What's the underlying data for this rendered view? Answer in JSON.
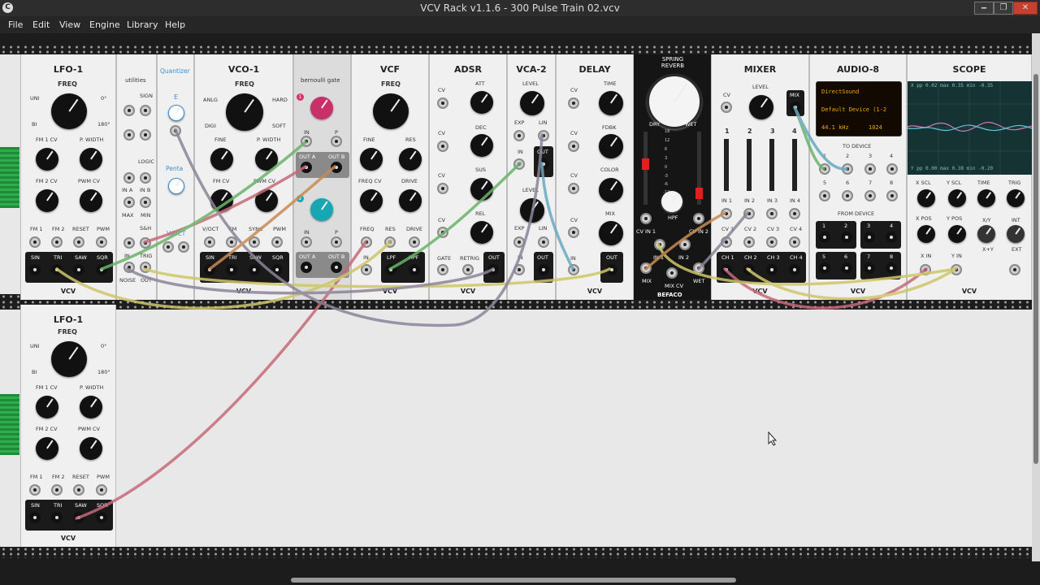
{
  "window": {
    "title": "VCV Rack v1.1.6 - 300 Pulse Train 02.vcv",
    "logo": "C",
    "controls": [
      "🗕",
      "❐",
      "✕"
    ]
  },
  "menu": [
    "File",
    "Edit",
    "View",
    "Engine",
    "Library",
    "Help"
  ],
  "modules": {
    "lfo1": {
      "title": "LFO-1",
      "freq": "FREQ",
      "uni": "UNI",
      "bi": "BI",
      "deg0": "0°",
      "deg180": "180°",
      "fm1cv": "FM 1 CV",
      "pwidth": "P. WIDTH",
      "fm2cv": "FM 2 CV",
      "pwmcv": "PWM CV",
      "in_labels": [
        "FM 1",
        "FM 2",
        "RESET",
        "PWM"
      ],
      "out_labels": [
        "SIN",
        "TRI",
        "SAW",
        "SQR"
      ],
      "logo": "VCV"
    },
    "utilities": {
      "title": "utilities",
      "sign": "SIGN",
      "logic": "LOGIC",
      "ina": "IN A",
      "inb": "IN B",
      "max": "MAX",
      "min": "MIN",
      "sh": "S&H",
      "in": "IN",
      "trig": "TRIG",
      "noise": "NOISE",
      "out": "OUT"
    },
    "quantizer": {
      "title": "Quantizer",
      "scale1": "E",
      "scale2": "Penta",
      "voct": "V/OCT"
    },
    "vco1": {
      "title": "VCO-1",
      "freq": "FREQ",
      "anlg": "ANLG",
      "digi": "DIGI",
      "hard": "HARD",
      "soft": "SOFT",
      "fine": "FINE",
      "pwidth": "P. WIDTH",
      "fmcv": "FM CV",
      "pwmcv": "PWM CV",
      "in_labels": [
        "V/OCT",
        "FM",
        "SYNC",
        "PWM"
      ],
      "out_labels": [
        "SIN",
        "TRI",
        "SAW",
        "SQR"
      ],
      "logo": "VCV"
    },
    "bernoulli": {
      "title": "bernoulli gate",
      "in": "IN",
      "p": "P",
      "outa": "OUT A",
      "outb": "OUT B",
      "n1": "1",
      "n2": "2"
    },
    "vcf": {
      "title": "VCF",
      "freq": "FREQ",
      "fine": "FINE",
      "res": "RES",
      "freqcv": "FREQ CV",
      "drive": "DRIVE",
      "in_labels": [
        "FREQ",
        "RES",
        "DRIVE"
      ],
      "out_labels": [
        "IN",
        "LPF",
        "HPF"
      ],
      "logo": "VCV"
    },
    "adsr": {
      "title": "ADSR",
      "att": "ATT",
      "dec": "DEC",
      "sus": "SUS",
      "rel": "REL",
      "cv": "CV",
      "gate": "GATE",
      "retrig": "RETRIG",
      "out": "OUT",
      "logo": "VCV"
    },
    "vca2": {
      "title": "VCA-2",
      "level": "LEVEL",
      "exp": "EXP",
      "lin": "LIN",
      "in": "IN",
      "out": "OUT",
      "logo": "VCV"
    },
    "delay": {
      "title": "DELAY",
      "time": "TIME",
      "fdbk": "FDBK",
      "color": "COLOR",
      "mix": "MIX",
      "cv": "CV",
      "in": "IN",
      "out": "OUT",
      "logo": "VCV"
    },
    "spring": {
      "title": "SPRING REVERB",
      "dry": "DRY",
      "wet": "WET",
      "hpf": "HPF",
      "scale": [
        "18",
        "12",
        "6",
        "3",
        "0",
        "-3",
        "-6",
        "-12",
        "dB"
      ],
      "cvin1": "CV IN 1",
      "cvin2": "CV IN 2",
      "in1": "IN 1",
      "in2": "IN 2",
      "mix": "MIX",
      "mixcv": "MIX CV",
      "brand": "BEFACO"
    },
    "mixer": {
      "title": "MIXER",
      "level": "LEVEL",
      "cv": "CV",
      "mix": "MIX",
      "ch_nums": [
        "1",
        "2",
        "3",
        "4"
      ],
      "in_labels": [
        "IN 1",
        "IN 2",
        "IN 3",
        "IN 4"
      ],
      "cv_labels": [
        "CV 1",
        "CV 2",
        "CV 3",
        "CV 4"
      ],
      "out_labels": [
        "CH 1",
        "CH 2",
        "CH 3",
        "CH 4"
      ],
      "logo": "VCV"
    },
    "audio8": {
      "title": "AUDIO-8",
      "driver": "DirectSound",
      "device": "Default Device (1-2",
      "rate": "44.1 kHz",
      "block": "1024",
      "to_device": "TO DEVICE",
      "from_device": "FROM DEVICE",
      "to_nums": [
        "1",
        "2",
        "3",
        "4",
        "5",
        "6",
        "7",
        "8"
      ],
      "from_nums": [
        "1",
        "2",
        "3",
        "4",
        "5",
        "6",
        "7",
        "8"
      ],
      "logo": "VCV"
    },
    "scope": {
      "title": "SCOPE",
      "hdr1": "X  pp  0.02  max  0.35  min  -0.35",
      "hdr2": "Y  pp  0.00  max  0.38  min  -0.20",
      "xscl": "X SCL",
      "yscl": "Y SCL",
      "time": "TIME",
      "trig": "TRIG",
      "xpos": "X POS",
      "ypos": "Y POS",
      "xy": "X/Y",
      "xpy": "X+Y",
      "int": "INT",
      "ext": "EXT",
      "xin": "X IN",
      "yin": "Y IN",
      "logo": "VCV"
    },
    "lfo1b": {
      "title": "LFO-1",
      "freq": "FREQ",
      "uni": "UNI",
      "bi": "BI",
      "deg0": "0°",
      "deg180": "180°",
      "fm1cv": "FM 1 CV",
      "pwidth": "P. WIDTH",
      "fm2cv": "FM 2 CV",
      "pwmcv": "PWM CV",
      "in_labels": [
        "FM 1",
        "FM 2",
        "RESET",
        "PWM"
      ],
      "out_labels": [
        "SIN",
        "TRI",
        "SAW",
        "SQR"
      ],
      "logo": "VCV"
    }
  },
  "colors": {
    "cable_pink": "#c76a78",
    "cable_yellow": "#cfc66a",
    "cable_grey": "#8c8499",
    "cable_green": "#6bb36b",
    "cable_blue": "#6aa9c0",
    "cable_orange": "#c98b52"
  }
}
